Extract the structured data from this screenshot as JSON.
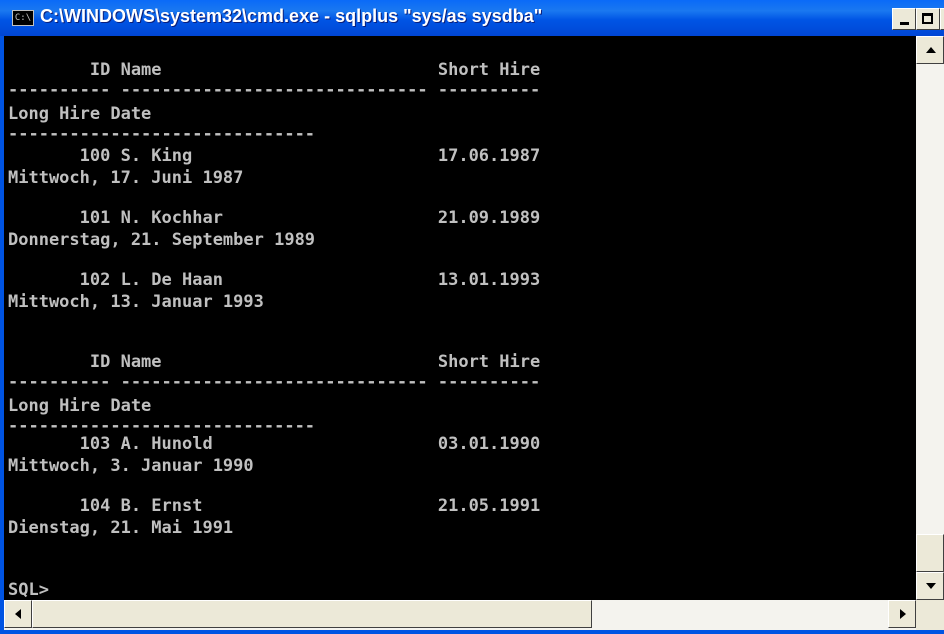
{
  "window": {
    "title": "C:\\WINDOWS\\system32\\cmd.exe - sqlplus \"sys/as sysdba\"",
    "icon_label": "C:\\"
  },
  "console": {
    "lines": [
      "        ID Name                           Short Hire",
      "---------- ------------------------------ ----------",
      "Long Hire Date",
      "------------------------------",
      "       100 S. King                        17.06.1987",
      "Mittwoch, 17. Juni 1987",
      "",
      "       101 N. Kochhar                     21.09.1989",
      "Donnerstag, 21. September 1989",
      "",
      "       102 L. De Haan                     13.01.1993",
      "Mittwoch, 13. Januar 1993",
      "",
      "",
      "        ID Name                           Short Hire",
      "---------- ------------------------------ ----------",
      "Long Hire Date",
      "------------------------------",
      "       103 A. Hunold                      03.01.1990",
      "Mittwoch, 3. Januar 1990",
      "",
      "       104 B. Ernst                       21.05.1991",
      "Dienstag, 21. Mai 1991",
      "",
      "",
      "SQL>"
    ]
  },
  "colors": {
    "titlebar": "#0054e3",
    "console_bg": "#000000",
    "console_text": "#c0c0c0"
  },
  "icons": [
    "cmd-app-icon",
    "minimize-icon",
    "maximize-icon",
    "close-icon",
    "scroll-up-arrow-icon",
    "scroll-down-arrow-icon",
    "scroll-left-arrow-icon",
    "scroll-right-arrow-icon"
  ]
}
